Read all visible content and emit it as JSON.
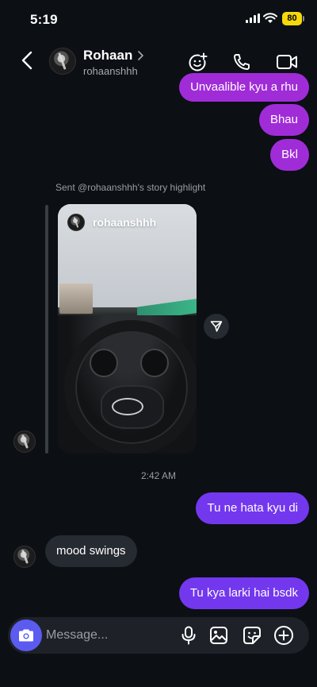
{
  "status_bar": {
    "time": "5:19",
    "battery": "80"
  },
  "header": {
    "contact_name": "Rohaan",
    "username": "rohaanshhh",
    "icons": [
      "back-icon",
      "add-effects-icon",
      "phone-icon",
      "video-icon"
    ]
  },
  "messages": [
    {
      "from": "me",
      "text": "Unvaalible kyu a rhu"
    },
    {
      "from": "me",
      "text": "Bhau"
    },
    {
      "from": "me",
      "text": "Bkl"
    }
  ],
  "story": {
    "caption": "Sent @rohaanshhh's story highlight",
    "owner": "rohaanshhh"
  },
  "timestamp": "2:42 AM",
  "messages_after": [
    {
      "from": "me",
      "text": "Tu ne hata kyu di"
    },
    {
      "from": "them",
      "text": "mood swings"
    },
    {
      "from": "me",
      "text": "Tu kya larki hai bsdk"
    }
  ],
  "composer": {
    "placeholder": "Message..."
  },
  "colors": {
    "bubble_purple": "#a02cd8",
    "bubble_violet": "#7338ee",
    "bubble_gray": "#262a31",
    "camera_button": "#5b5bf0",
    "background": "#0c0f14"
  }
}
